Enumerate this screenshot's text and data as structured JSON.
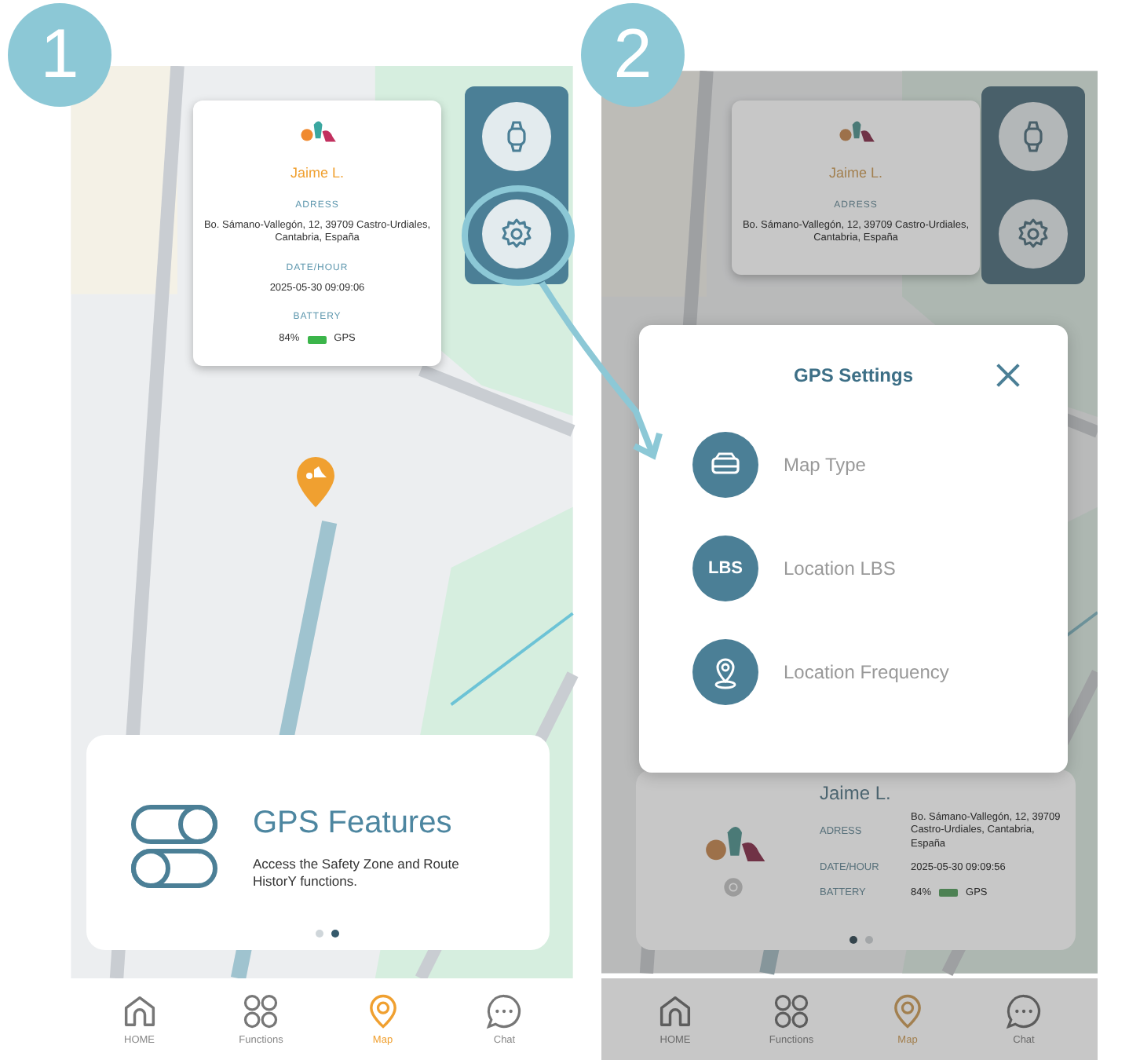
{
  "panels": [
    {
      "step": "1",
      "dimmed": false,
      "popup": {
        "name": "Jaime L.",
        "fields": [
          {
            "kind": "text",
            "label": "ADRESS",
            "value": "Bo. Sámano-Vallegón, 12, 39709 Castro-Urdiales, Cantabria, España"
          },
          {
            "kind": "text",
            "label": "DATE/HOUR",
            "value": "2025-05-30 09:09:06"
          },
          {
            "kind": "battery",
            "label": "BATTERY",
            "percent": "84%",
            "mode": "GPS"
          }
        ]
      },
      "side_buttons": [
        {
          "kind": "watch"
        },
        {
          "kind": "gear"
        }
      ],
      "pin": true,
      "card": {
        "kind": "feature",
        "title": "GPS Features",
        "text": "Access the Safety Zone and Route HistorY functions.",
        "dots": [
          {
            "selected": false
          },
          {
            "selected": true
          }
        ]
      },
      "tabs": [
        {
          "kind": "home",
          "label": "HOME",
          "selected": false
        },
        {
          "kind": "functions",
          "label": "Functions",
          "selected": false
        },
        {
          "kind": "map",
          "label": "Map",
          "selected": true
        },
        {
          "kind": "chat",
          "label": "Chat",
          "selected": false
        }
      ]
    },
    {
      "step": "2",
      "dimmed": true,
      "popup": {
        "name": "Jaime L.",
        "fields": [
          {
            "kind": "text",
            "label": "ADRESS",
            "value": "Bo. Sámano-Vallegón, 12, 39709 Castro-Urdiales, Cantabria, España"
          }
        ]
      },
      "side_buttons": [
        {
          "kind": "watch"
        },
        {
          "kind": "gear"
        }
      ],
      "pin": false,
      "card": {
        "kind": "tracker",
        "name": "Jaime L.",
        "fields": [
          {
            "kind": "text",
            "label": "ADRESS",
            "value": "Bo. Sámano-Vallegón, 12, 39709 Castro-Urdiales, Cantabria, España"
          },
          {
            "kind": "text",
            "label": "DATE/HOUR",
            "value": "2025-05-30 09:09:56"
          },
          {
            "kind": "battery",
            "label": "BATTERY",
            "percent": "84%",
            "mode": "GPS"
          }
        ],
        "dots": [
          {
            "selected": true
          },
          {
            "selected": false
          }
        ]
      },
      "tabs": [
        {
          "kind": "home",
          "label": "HOME",
          "selected": false
        },
        {
          "kind": "functions",
          "label": "Functions",
          "selected": false
        },
        {
          "kind": "map",
          "label": "Map",
          "selected": true
        },
        {
          "kind": "chat",
          "label": "Chat",
          "selected": false
        }
      ],
      "modal": {
        "title": "GPS Settings",
        "items": [
          {
            "kind": "map",
            "label": "Map Type"
          },
          {
            "kind": "badge",
            "badge": "LBS",
            "label": "Location LBS"
          },
          {
            "kind": "pin",
            "label": "Location Frequency"
          }
        ]
      }
    }
  ]
}
